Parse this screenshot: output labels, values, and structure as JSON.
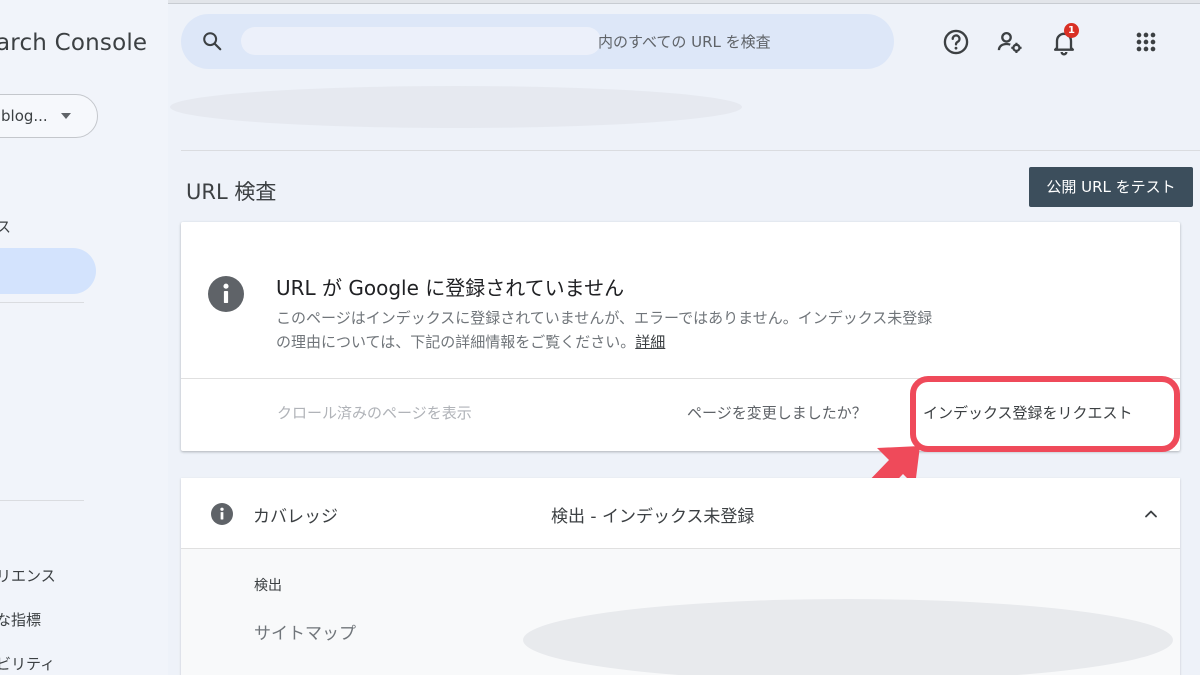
{
  "app": {
    "title": "arch Console"
  },
  "sidebar": {
    "property_label": "blog...",
    "items": [
      {
        "label": "ス"
      },
      {
        "label": "リエンス"
      },
      {
        "label": "な指標"
      },
      {
        "label": "ビリティ"
      }
    ]
  },
  "search": {
    "placeholder": "内のすべての URL を検査"
  },
  "header": {
    "notification_count": "1"
  },
  "page": {
    "title": "URL 検査",
    "test_button": "公開 URL をテスト"
  },
  "status_card": {
    "title": "URL が Google に登録されていません",
    "description": "このページはインデックスに登録されていませんが、エラーではありません。インデックス未登録の理由については、下記の詳細情報をご覧ください。",
    "details_link": "詳細",
    "view_crawled": "クロール済みのページを表示",
    "changed_question": "ページを変更しましたか？",
    "request_indexing": "インデックス登録をリクエスト"
  },
  "coverage": {
    "label": "カバレッジ",
    "status": "検出 - インデックス未登録",
    "section_label": "検出",
    "sitemap_label": "サイトマップ"
  },
  "colors": {
    "highlight": "#ef4a5a",
    "test_button_bg": "#3c4e5c",
    "badge": "#d93025"
  }
}
